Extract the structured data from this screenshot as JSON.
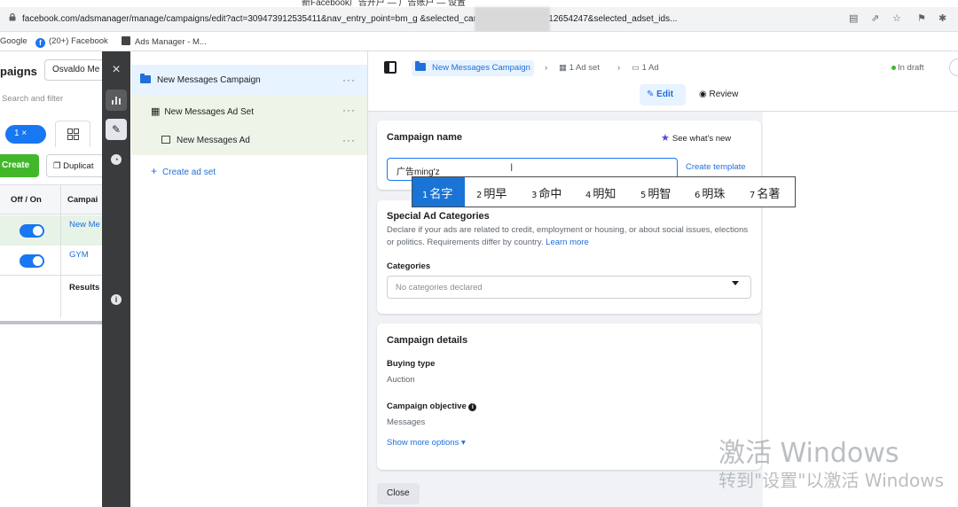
{
  "browser": {
    "title_fragment": "新Facebook广告开户 — 广告账户 — 设置",
    "url": "facebook.com/adsmanager/manage/campaigns/edit?act=309473912535411&nav_entry_point=bm_g                    &selected_campaign_ids=6278812654247&selected_adset_ids...",
    "bookmarks": [
      "Google",
      "(20+) Facebook",
      "Ads Manager - M..."
    ]
  },
  "left_panel": {
    "title": "paigns",
    "account": "Osvaldo Me",
    "search_placeholder": "Search and filter",
    "filter_pill": "1 ×",
    "create_label": "Create",
    "duplicate_label": "Duplicat",
    "col_onoff": "Off / On",
    "col_campaign": "Campai",
    "rows": [
      {
        "name": "New Me",
        "on": true
      },
      {
        "name": "GYM",
        "on": true
      }
    ],
    "results_label": "Results"
  },
  "tree": {
    "campaign": "New Messages Campaign",
    "adset": "New Messages Ad Set",
    "ad": "New Messages Ad",
    "more": "···",
    "create_adset": "Create ad set"
  },
  "editor": {
    "crumb_campaign": "New Messages Campaign",
    "crumb_adset": "1 Ad set",
    "crumb_ad": "1 Ad",
    "status": "In draft",
    "edit_tab": "Edit",
    "review_tab": "Review",
    "campaign_name_label": "Campaign name",
    "see_whats_new": "See what's new",
    "campaign_name_value": "广告ming'z",
    "create_template": "Create template",
    "ime_candidates": [
      {
        "n": "1",
        "text": "名字"
      },
      {
        "n": "2",
        "text": "明早"
      },
      {
        "n": "3",
        "text": "命中"
      },
      {
        "n": "4",
        "text": "明知"
      },
      {
        "n": "5",
        "text": "明智"
      },
      {
        "n": "6",
        "text": "明珠"
      },
      {
        "n": "7",
        "text": "名著"
      }
    ],
    "special_title": "Special Ad Categories",
    "special_desc": "Declare if your ads are related to credit, employment or housing, or about social issues, elections or politics. Requirements differ by country.",
    "learn_more": "Learn more",
    "categories_label": "Categories",
    "categories_placeholder": "No categories declared",
    "details_title": "Campaign details",
    "buying_type_label": "Buying type",
    "buying_type_value": "Auction",
    "objective_label": "Campaign objective",
    "objective_value": "Messages",
    "show_more": "Show more options ▾",
    "close_label": "Close"
  },
  "watermark": {
    "line1": "激活 Windows",
    "line2": "转到\"设置\"以激活 Windows"
  },
  "colors": {
    "accent": "#1877f2",
    "link": "#216fdb",
    "create_green": "#42b72a",
    "rail": "#3a3b3c",
    "ime_highlight": "#1a74d6"
  }
}
